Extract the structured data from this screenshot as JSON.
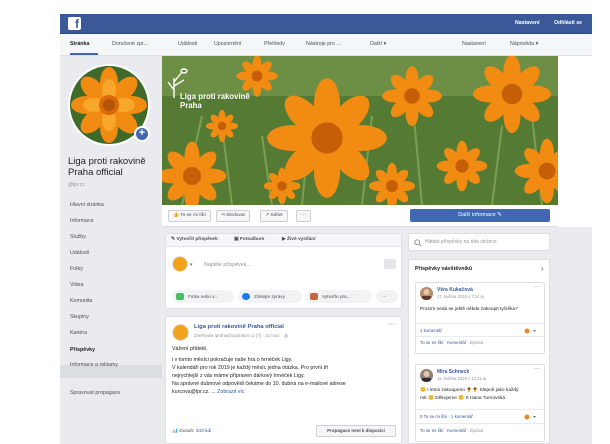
{
  "topbar": {
    "brand_letter": "f",
    "links": [
      "Nastavení",
      "Odhlásit se"
    ]
  },
  "tabs": [
    "Stránka",
    "Doručené zpr...",
    "Události",
    "Upozornění",
    "Přehledy",
    "Nástroje pro ...",
    "Další ▾"
  ],
  "tabs_right": [
    "Nastavení",
    "Nápověda ▾"
  ],
  "page": {
    "name": "Liga proti rakovině Praha official",
    "handle": "@lpr.cz",
    "cover_title": [
      "Liga proti rakovině",
      "Praha"
    ]
  },
  "sidebar": {
    "items": [
      "Hlavní stránka",
      "Informace",
      "Služby",
      "Události",
      "Fotky",
      "Videa",
      "Komunita",
      "Skupiny",
      "Kariéra",
      "Příspěvky",
      "Informace a reklamy"
    ],
    "active_index": 9,
    "manage_promotions": "Spravovat propagace"
  },
  "actions": {
    "like": "👍 To se mi líbí",
    "follow": "⤳ Sledovat",
    "share": "↗ Sdílet",
    "more": "···",
    "cta": "Další informace ✎"
  },
  "composer": {
    "tabs": [
      "✎ Vytvořit příspěvek",
      "▣ Fotoalbum",
      "▶ Živé vysílání"
    ],
    "placeholder": "Napište příspěvek...",
    "pills": [
      "Fotka nebo v...",
      "Získejte zprávy",
      "Vytvořte pra...",
      "···"
    ]
  },
  "post": {
    "author": "Liga proti rakovině Praha official",
    "meta": "Zveřejnila lpraha@ozprasm.cz [?] · 22 hod. · ◍",
    "more": "···",
    "lines": [
      "Vážení přátelé,",
      "i v tomto měsíci pokračuje naše hra o hrnéček Ligy.",
      "V kalendáři pro rok 2019 je každý měsíc jedna otázka. Pro první tři",
      "nejrychlejší z vás máme připraven dárkový hrnéček Ligy.",
      "Na správné dubnové odpovědi čekáme do 10. dubna na e-mailové adrese",
      "kurcova@lpr.cz. ..."
    ],
    "see_more": "Zobrazit víc",
    "reach_label": "Dosah:",
    "reach_value": "343 lidí",
    "boost": "Propagace není k dispozici"
  },
  "right": {
    "search_placeholder": "Hledat příspěvky na této stránce",
    "panel_title": "Příspěvky návštěvníků",
    "cards": [
      {
        "name": "Věra Kukačová",
        "date": "17. května 2018 v 7:14 ◍",
        "text": [
          "Prosím nedá se ještě někde zakoupit tyčtěka?"
        ],
        "stat": "1 komentář",
        "actions": [
          "To se mi líbí",
          "Komentář",
          "Zpráva"
        ]
      },
      {
        "name": "Mira Schneck",
        "date": "15. května 2018 v 12:21 ◍",
        "text": [
          "😊 I letos zakoupeno 🌻🌻 Slepně jako každý",
          "rok 😊 Děkujeme 😊 S Hana Turnovská"
        ],
        "stat": "5 To se mi líbí · 1 komentář",
        "actions": [
          "To se mi líbí",
          "Komentář",
          "Zpráva"
        ]
      }
    ]
  },
  "colors": {
    "brand_blue": "#3b5998",
    "button_blue": "#4267b2",
    "link_blue": "#385898",
    "page_bg": "#e9ebee"
  }
}
